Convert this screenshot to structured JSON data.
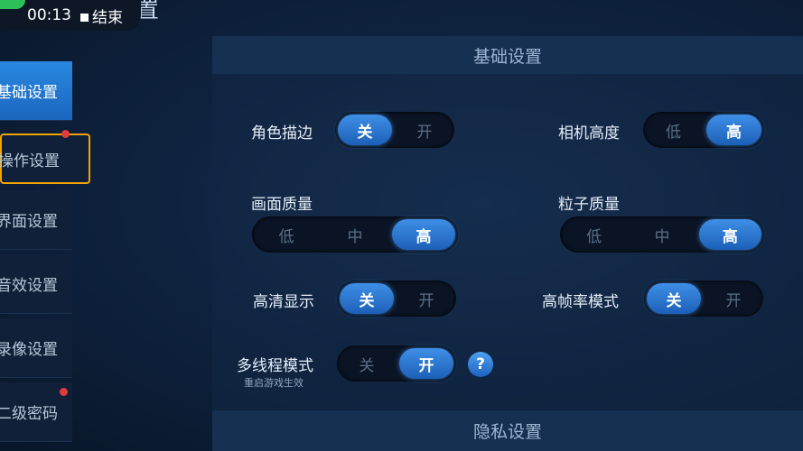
{
  "recording": {
    "time": "00:13",
    "end_label": "结束"
  },
  "top_title": "置",
  "sidebar": {
    "items": [
      {
        "label": "基础设置"
      },
      {
        "label": "操作设置"
      },
      {
        "label": "界面设置"
      },
      {
        "label": "音效设置"
      },
      {
        "label": "录像设置"
      },
      {
        "label": "二级密码"
      }
    ]
  },
  "sections": {
    "basic": "基础设置",
    "privacy": "隐私设置"
  },
  "settings": {
    "outline": {
      "label": "角色描边",
      "options": [
        "关",
        "开"
      ],
      "selected": 0
    },
    "camera": {
      "label": "相机高度",
      "options": [
        "低",
        "高"
      ],
      "selected": 1
    },
    "quality": {
      "label": "画面质量",
      "options": [
        "低",
        "中",
        "高"
      ],
      "selected": 2
    },
    "particles": {
      "label": "粒子质量",
      "options": [
        "低",
        "中",
        "高"
      ],
      "selected": 2
    },
    "hd": {
      "label": "高清显示",
      "options": [
        "关",
        "开"
      ],
      "selected": 0
    },
    "hfr": {
      "label": "高帧率模式",
      "options": [
        "关",
        "开"
      ],
      "selected": 0
    },
    "multithread": {
      "label": "多线程模式",
      "sublabel": "重启游戏生效",
      "options": [
        "关",
        "开"
      ],
      "selected": 1
    }
  },
  "help_icon": "?"
}
